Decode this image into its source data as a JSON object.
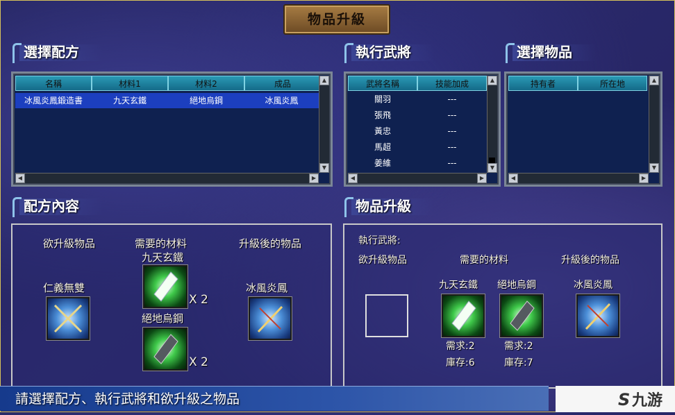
{
  "title": "物品升級",
  "recipe_section": {
    "heading": "選擇配方",
    "columns": [
      "名稱",
      "材料1",
      "材料2",
      "成品"
    ],
    "rows": [
      [
        "冰風炎鳳鍛造書",
        "九天玄鐵",
        "絕地烏鋼",
        "冰風炎鳳"
      ]
    ]
  },
  "general_section": {
    "heading": "執行武將",
    "columns": [
      "武將名稱",
      "技能加成"
    ],
    "rows": [
      [
        "關羽",
        "---"
      ],
      [
        "張飛",
        "---"
      ],
      [
        "黃忠",
        "---"
      ],
      [
        "馬超",
        "---"
      ],
      [
        "姜維",
        "---"
      ]
    ]
  },
  "item_section": {
    "heading": "選擇物品",
    "columns": [
      "持有者",
      "所在地"
    ]
  },
  "recipe_content": {
    "heading": "配方內容",
    "col_upgrade_item": "欲升級物品",
    "col_required": "需要的材料",
    "col_result": "升級後的物品",
    "upgrade_item_name": "仁義無雙",
    "material1_name": "九天玄鐵",
    "material1_qty": "X 2",
    "material2_name": "絕地烏鋼",
    "material2_qty": "X 2",
    "result_name": "冰風炎鳳"
  },
  "upgrade_panel": {
    "heading": "物品升級",
    "general_label": "執行武將:",
    "col_upgrade_item": "欲升級物品",
    "col_required": "需要的材料",
    "col_result": "升級後的物品",
    "material1_name": "九天玄鐵",
    "material1_need": "需求:2",
    "material1_stock": "庫存:6",
    "material2_name": "絕地烏鋼",
    "material2_need": "需求:2",
    "material2_stock": "庫存:7",
    "result_name": "冰風炎鳳"
  },
  "status_text": "請選擇配方、執行武將和欲升級之物品",
  "logo_text": "九游",
  "colors": {
    "accent": "#1c3fbf",
    "header": "#2a9ab5"
  }
}
